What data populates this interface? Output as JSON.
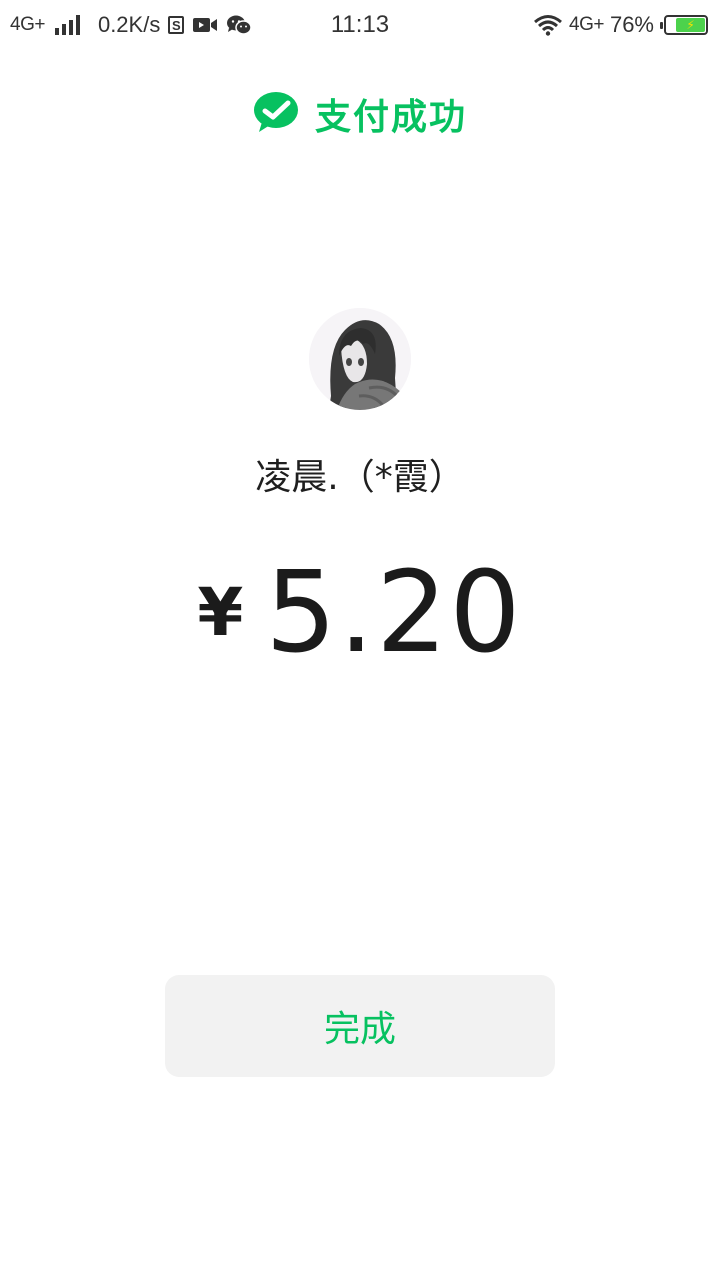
{
  "status_bar": {
    "network_left": "4G+",
    "speed": "0.2K/s",
    "s_icon_label": "S",
    "time": "11:13",
    "network_right": "4G+",
    "battery_percent": "76%",
    "battery_level": 0.76,
    "icons": [
      "signal-icon",
      "s-app-icon",
      "video-icon",
      "wechat-icon",
      "wifi-icon",
      "battery-icon"
    ]
  },
  "header": {
    "title": "支付成功",
    "icon": "check-circle-icon",
    "accent_color": "#07c160"
  },
  "payee": {
    "name": "凌晨.（*霞）",
    "avatar": "anime-avatar"
  },
  "amount": {
    "currency": "¥",
    "value": "5.20"
  },
  "actions": {
    "done_label": "完成"
  }
}
